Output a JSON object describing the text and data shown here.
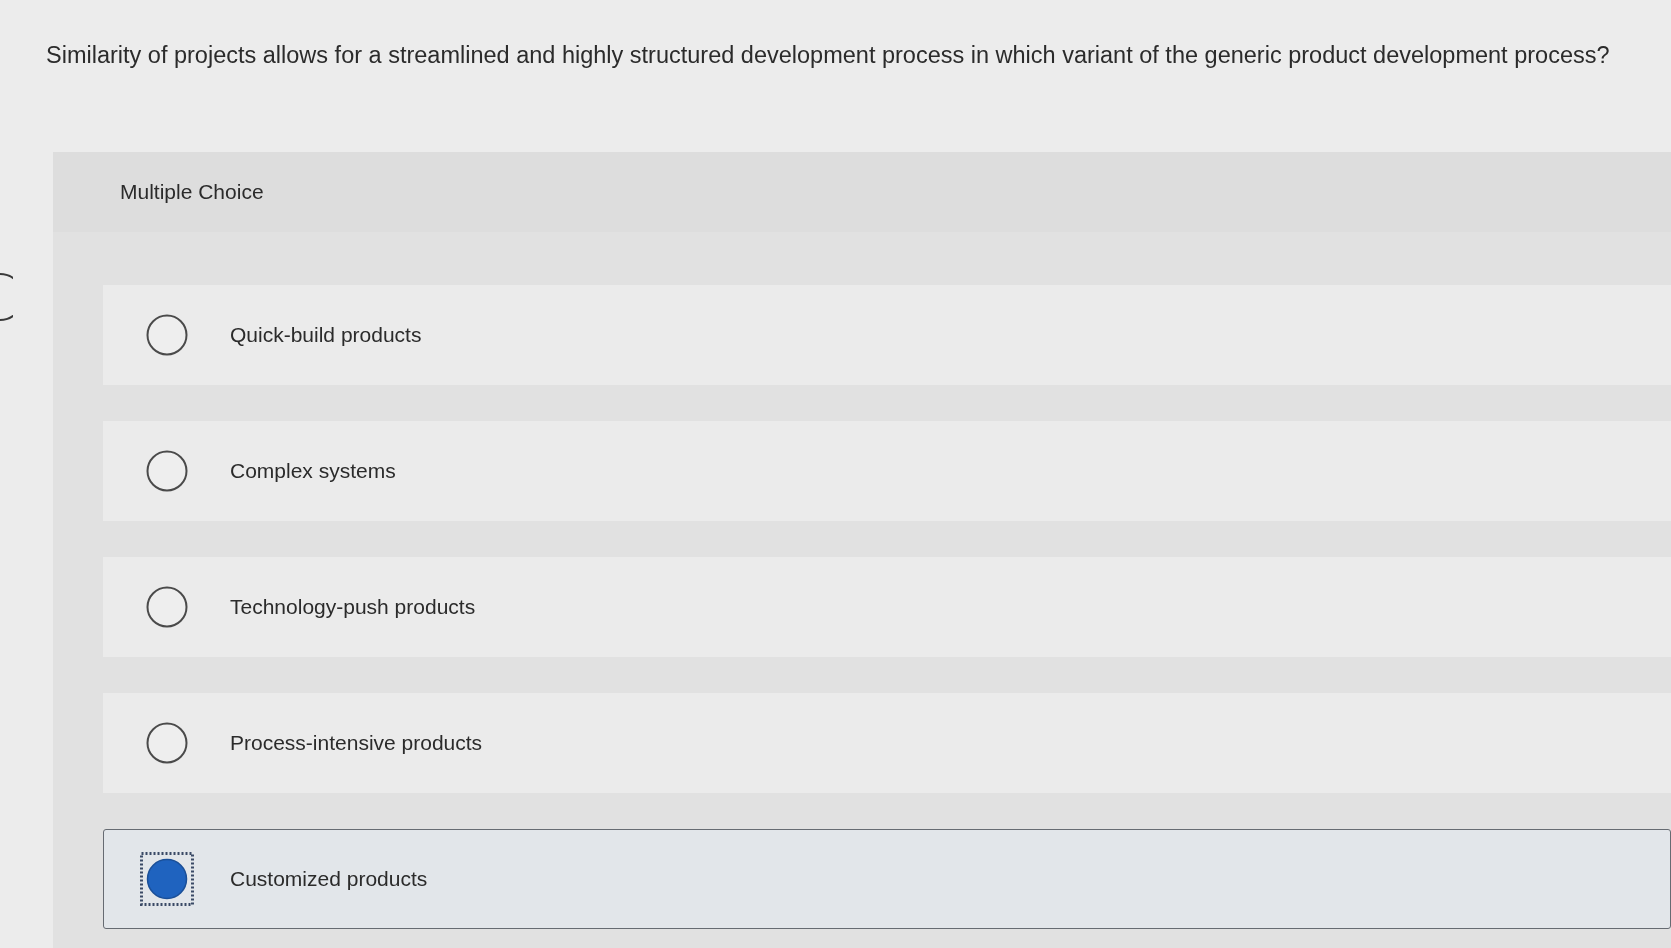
{
  "question": "Similarity of projects allows for a streamlined and highly structured development process in which variant of the generic product development process?",
  "answer_panel": {
    "heading": "Multiple Choice",
    "options": [
      {
        "label": "Quick-build products",
        "selected": false,
        "focused": false
      },
      {
        "label": "Complex systems",
        "selected": false,
        "focused": false
      },
      {
        "label": "Technology-push products",
        "selected": false,
        "focused": false
      },
      {
        "label": "Process-intensive products",
        "selected": false,
        "focused": false
      },
      {
        "label": "Customized products",
        "selected": true,
        "focused": true
      }
    ]
  }
}
